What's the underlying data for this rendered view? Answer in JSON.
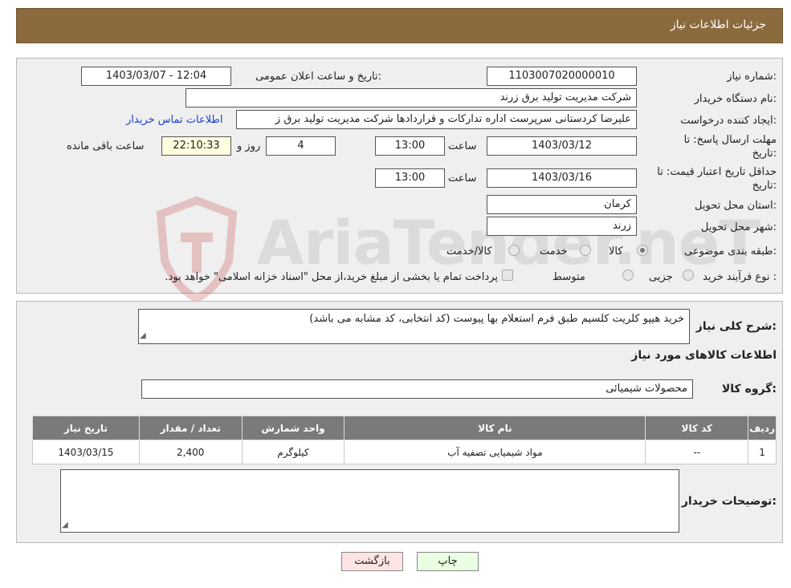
{
  "header": {
    "title": "جزئیات اطلاعات نیاز"
  },
  "form": {
    "need_number_label": "شماره نیاز:",
    "need_number_value": "1103007020000010",
    "announce_label": "تاریخ و ساعت اعلان عمومی:",
    "announce_value": "1403/03/07 - 12:04",
    "buyer_org_label": "نام دستگاه خریدار:",
    "buyer_org_value": "شرکت مدیریت تولید برق زرند",
    "requester_label": "ایجاد کننده درخواست:",
    "requester_value": "علیرضا کردستانی سرپرست اداره تدارکات و قراردادها شرکت مدیریت تولید برق ز",
    "contact_link": "اطلاعات تماس خریدار",
    "deadline_label_1": "مهلت ارسال پاسخ: تا",
    "deadline_label_2": "تاریخ:",
    "deadline_date": "1403/03/12",
    "time_label": "ساعت",
    "deadline_time": "13:00",
    "days_value": "4",
    "days_label": "روز و",
    "remaining_value": "22:10:33",
    "remaining_label": "ساعت باقی مانده",
    "validity_label_1": "حداقل تاریخ اعتبار قیمت: تا",
    "validity_label_2": "تاریخ:",
    "validity_date": "1403/03/16",
    "validity_time": "13:00",
    "province_label": "استان محل تحویل:",
    "province_value": "کرمان",
    "city_label": "شهر محل تحویل:",
    "city_value": "زرند",
    "category_label": "طبقه بندی موضوعی:",
    "category_options": [
      "کالا",
      "خدمت",
      "کالا/خدمت"
    ],
    "process_label": "نوع فرآیند خرید :",
    "process_options": [
      "جزیی",
      "متوسط"
    ],
    "process_note": "پرداخت تمام یا بخشی از مبلغ خرید،از محل \"اسناد خزانه اسلامی\" خواهد بود."
  },
  "description": {
    "label": "شرح کلی نیاز:",
    "value": "خرید هیپو کلریت کلسیم طبق فرم استعلام بها پیوست (کد انتخابی، کد مشابه می باشد)",
    "items_title": "اطلاعات کالاهای مورد نیاز",
    "group_label": "گروه کالا:",
    "group_value": "محصولات شیمیائی"
  },
  "table": {
    "headers": [
      "ردیف",
      "کد کالا",
      "نام کالا",
      "واحد شمارش",
      "تعداد / مقدار",
      "تاریخ نیاز"
    ],
    "rows": [
      [
        "1",
        "--",
        "مواد شیمیایی تصفیه آب",
        "کیلوگرم",
        "2,400",
        "1403/03/15"
      ]
    ]
  },
  "buyer_notes": {
    "label": "توضیحات خریدار:",
    "value": ""
  },
  "buttons": {
    "print": "چاپ",
    "back": "بازگشت"
  },
  "watermark": {
    "text": "AriaTender.neT"
  }
}
